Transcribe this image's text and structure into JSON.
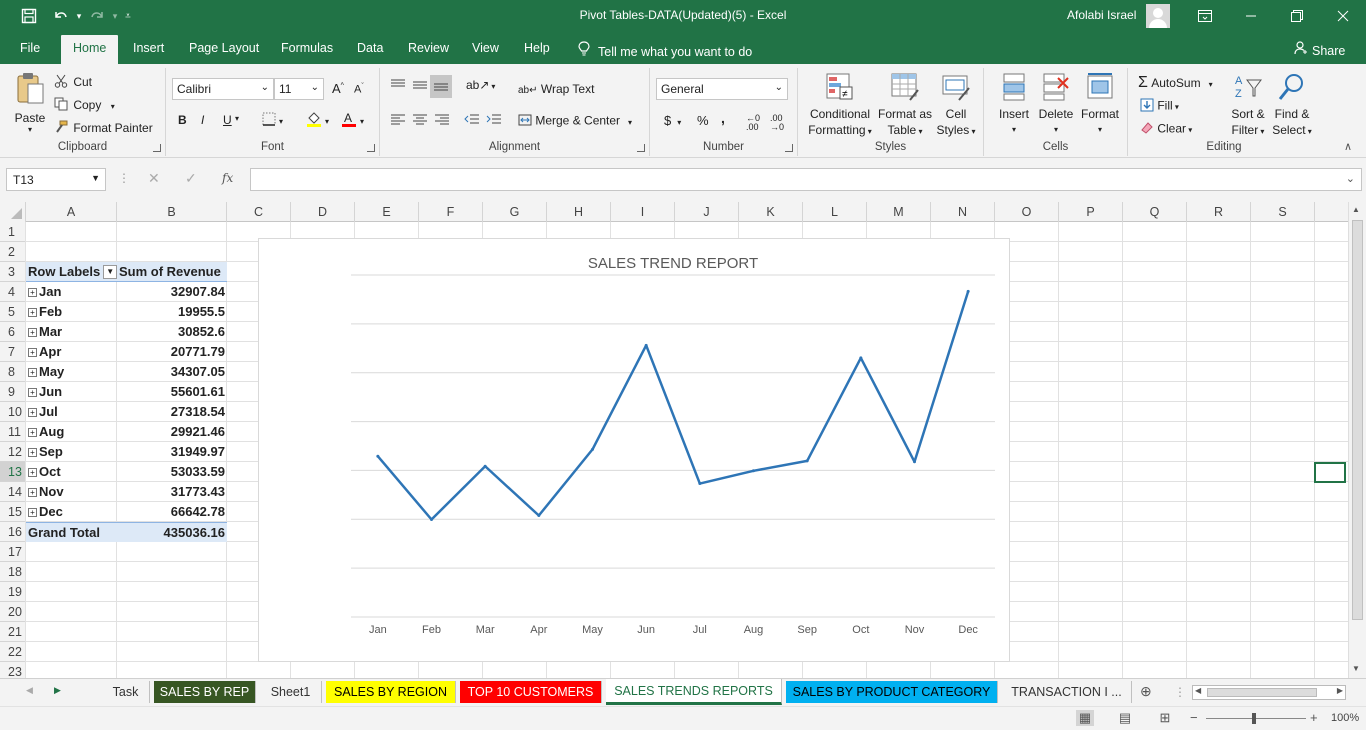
{
  "app": {
    "window_title": "Pivot Tables-DATA(Updated)(5)  -  Excel",
    "user_name": "Afolabi Israel"
  },
  "menu": {
    "tabs": [
      "File",
      "Home",
      "Insert",
      "Page Layout",
      "Formulas",
      "Data",
      "Review",
      "View",
      "Help"
    ],
    "active_tab": "Home",
    "tell_me": "Tell me what you want to do",
    "share": "Share"
  },
  "ribbon": {
    "clipboard": {
      "label": "Clipboard",
      "paste": "Paste",
      "cut": "Cut",
      "copy": "Copy",
      "format_painter": "Format Painter"
    },
    "font": {
      "label": "Font",
      "family": "Calibri",
      "size": "11",
      "bold": "B",
      "italic": "I",
      "underline": "U"
    },
    "alignment": {
      "label": "Alignment",
      "wrap_text": "Wrap Text",
      "merge_center": "Merge & Center"
    },
    "number": {
      "label": "Number",
      "format": "General",
      "currency": "$",
      "percent": "%",
      "comma": ","
    },
    "styles": {
      "label": "Styles",
      "conditional_l1": "Conditional",
      "conditional_l2": "Formatting",
      "format_table_l1": "Format as",
      "format_table_l2": "Table",
      "cell_styles_l1": "Cell",
      "cell_styles_l2": "Styles"
    },
    "cells": {
      "label": "Cells",
      "insert": "Insert",
      "delete": "Delete",
      "format": "Format"
    },
    "editing": {
      "label": "Editing",
      "autosum": "AutoSum",
      "fill": "Fill",
      "clear": "Clear",
      "sort_l1": "Sort &",
      "sort_l2": "Filter",
      "find_l1": "Find &",
      "find_l2": "Select"
    }
  },
  "formula_bar": {
    "name_box": "T13",
    "fx": "fx",
    "formula": ""
  },
  "columns": [
    "A",
    "B",
    "C",
    "D",
    "E",
    "F",
    "G",
    "H",
    "I",
    "J",
    "K",
    "L",
    "M",
    "N",
    "O",
    "P",
    "Q",
    "R",
    "S"
  ],
  "rows": [
    "1",
    "2",
    "3",
    "4",
    "5",
    "6",
    "7",
    "8",
    "9",
    "10",
    "11",
    "12",
    "13",
    "14",
    "15",
    "16",
    "17",
    "18",
    "19",
    "20",
    "21",
    "22",
    "23"
  ],
  "pivot": {
    "header_labels": "Row Labels",
    "header_values": "Sum of Revenue",
    "rows": [
      {
        "label": "Jan",
        "value": "32907.84"
      },
      {
        "label": "Feb",
        "value": "19955.5"
      },
      {
        "label": "Mar",
        "value": "30852.6"
      },
      {
        "label": "Apr",
        "value": "20771.79"
      },
      {
        "label": "May",
        "value": "34307.05"
      },
      {
        "label": "Jun",
        "value": "55601.61"
      },
      {
        "label": "Jul",
        "value": "27318.54"
      },
      {
        "label": "Aug",
        "value": "29921.46"
      },
      {
        "label": "Sep",
        "value": "31949.97"
      },
      {
        "label": "Oct",
        "value": "53033.59"
      },
      {
        "label": "Nov",
        "value": "31773.43"
      },
      {
        "label": "Dec",
        "value": "66642.78"
      }
    ],
    "grand_total_label": "Grand Total",
    "grand_total_value": "435036.16"
  },
  "chart_data": {
    "type": "line",
    "title": "SALES TREND REPORT",
    "categories": [
      "Jan",
      "Feb",
      "Mar",
      "Apr",
      "May",
      "Jun",
      "Jul",
      "Aug",
      "Sep",
      "Oct",
      "Nov",
      "Dec"
    ],
    "values": [
      32907.84,
      19955.5,
      30852.6,
      20771.79,
      34307.05,
      55601.61,
      27318.54,
      29921.46,
      31949.97,
      53033.59,
      31773.43,
      66642.78
    ],
    "ylim": [
      0,
      70000
    ],
    "grid": true,
    "y_tick_labels_visible": false,
    "line_color": "#2E75B6"
  },
  "sheets": {
    "tabs": [
      {
        "label": "Task",
        "bg": "#f3f3f3",
        "color": "#333"
      },
      {
        "label": "SALES BY REP",
        "bg": "#375623",
        "color": "#ffffff"
      },
      {
        "label": "Sheet1",
        "bg": "#f3f3f3",
        "color": "#333"
      },
      {
        "label": "SALES BY REGION",
        "bg": "#ffff00",
        "color": "#000000"
      },
      {
        "label": "TOP 10 CUSTOMERS",
        "bg": "#ff0000",
        "color": "#ffffff"
      },
      {
        "label": "SALES TRENDS REPORTS",
        "bg": "#ffffff",
        "color": "#217346"
      },
      {
        "label": "SALES BY PRODUCT CATEGORY",
        "bg": "#00b0f0",
        "color": "#000000"
      },
      {
        "label": "TRANSACTION I ...",
        "bg": "#f3f3f3",
        "color": "#333"
      }
    ],
    "active": "SALES TRENDS REPORTS"
  },
  "status": {
    "zoom": "100%"
  },
  "colors": {
    "excel_green": "#217346"
  }
}
